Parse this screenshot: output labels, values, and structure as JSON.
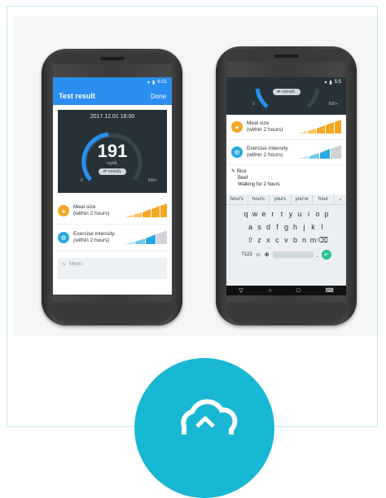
{
  "left_phone": {
    "status_time": "6:01",
    "app_title": "Test result",
    "done_label": "Done",
    "date": "2017.12.01 18:00",
    "glucose_value": "191",
    "glucose_unit": "mg/dL",
    "unit_pill": "mmol/L",
    "scale_min": "0",
    "scale_max": "600+",
    "meal_label_1": "Meal size",
    "meal_label_2": "(within 2 hours)",
    "exercise_label_1": "Exercise intensity",
    "exercise_label_2": "(within 2 hours)",
    "memo_placeholder": "Memo"
  },
  "right_phone": {
    "status_time": "5:5",
    "unit_pill": "mmol/L",
    "scale_min": "0",
    "scale_max": "600+",
    "meal_label_1": "Meal size",
    "meal_label_2": "(within 2 hours)",
    "exercise_label_1": "Exercise intensity",
    "exercise_label_2": "(within 2 hours)",
    "memo_line_1": "Rice",
    "memo_line_2": "Beef",
    "memo_line_3": "Walking for 2 hours",
    "suggestions": [
      "hour's",
      "hours",
      "yours",
      "you're",
      "hour"
    ],
    "row1": [
      "q",
      "w",
      "e",
      "r",
      "t",
      "y",
      "u",
      "i",
      "o",
      "p"
    ],
    "row2": [
      "a",
      "s",
      "d",
      "f",
      "g",
      "h",
      "j",
      "k",
      "l"
    ],
    "row3": [
      "z",
      "x",
      "c",
      "v",
      "b",
      "n",
      "m"
    ],
    "symbols_key": "?123"
  },
  "colors": {
    "accent": "#2b8ef0",
    "meal": "#f5a623",
    "exercise": "#29a8e0",
    "circle": "#18b7d3"
  },
  "icons": {
    "meal": "meal-icon",
    "exercise": "bicycle-icon",
    "cloud": "cloud-upload-icon"
  }
}
